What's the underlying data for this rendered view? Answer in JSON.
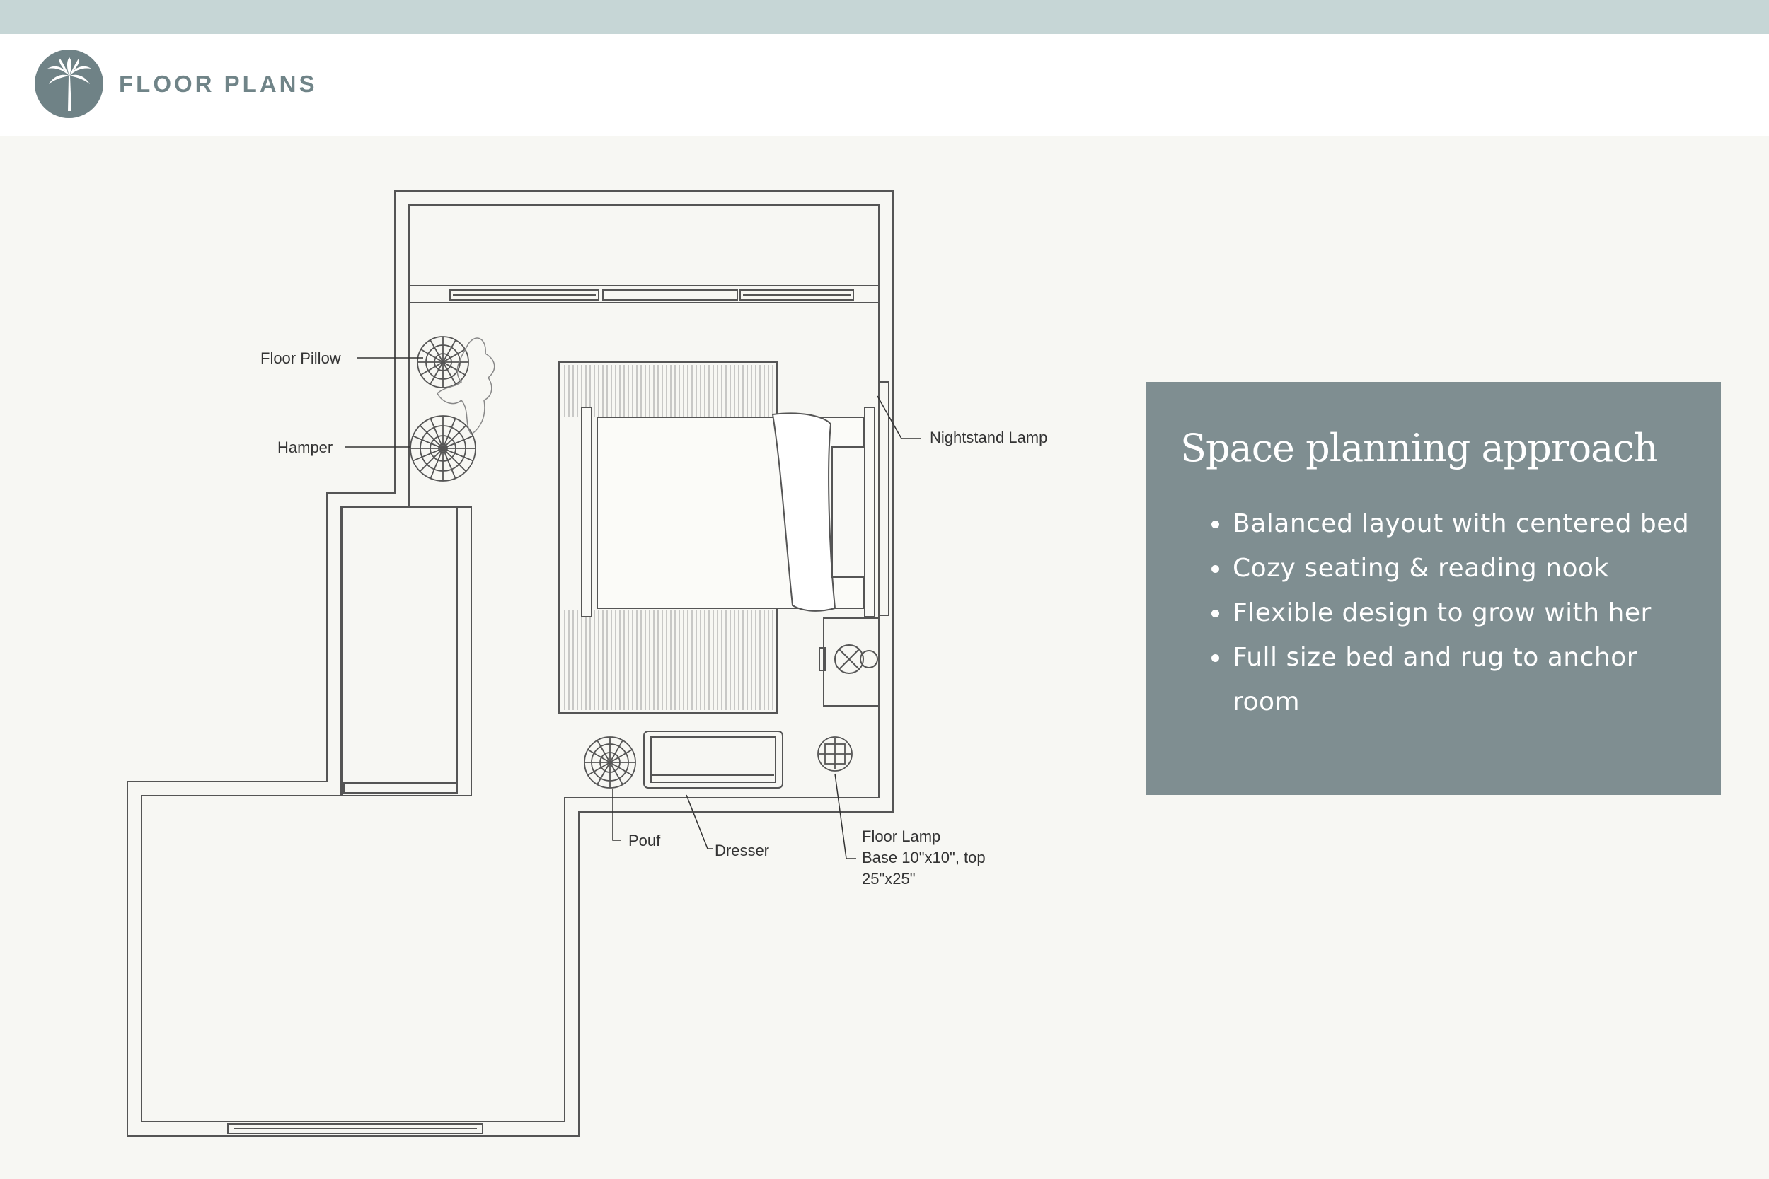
{
  "header": {
    "brand": "FLOOR PLANS",
    "logo_icon": "palm-tree-icon"
  },
  "plan": {
    "labels": {
      "floor_pillow": "Floor Pillow",
      "hamper": "Hamper",
      "nightstand_lamp": "Nightstand Lamp",
      "pouf": "Pouf",
      "dresser": "Dresser",
      "floor_lamp": "Floor Lamp",
      "floor_lamp_dims_1": "Base 10\"x10\", top",
      "floor_lamp_dims_2": "25\"x25\""
    }
  },
  "panel": {
    "title": "Space planning approach",
    "bullets": [
      "Balanced layout with centered bed",
      "Cozy seating & reading nook",
      "Flexible design to grow with her",
      "Full size bed and rug to anchor room"
    ]
  },
  "colors": {
    "topbar": "#c6d6d6",
    "panel": "#7f8e91",
    "logo": "#6f8286",
    "background": "#f7f7f3"
  }
}
